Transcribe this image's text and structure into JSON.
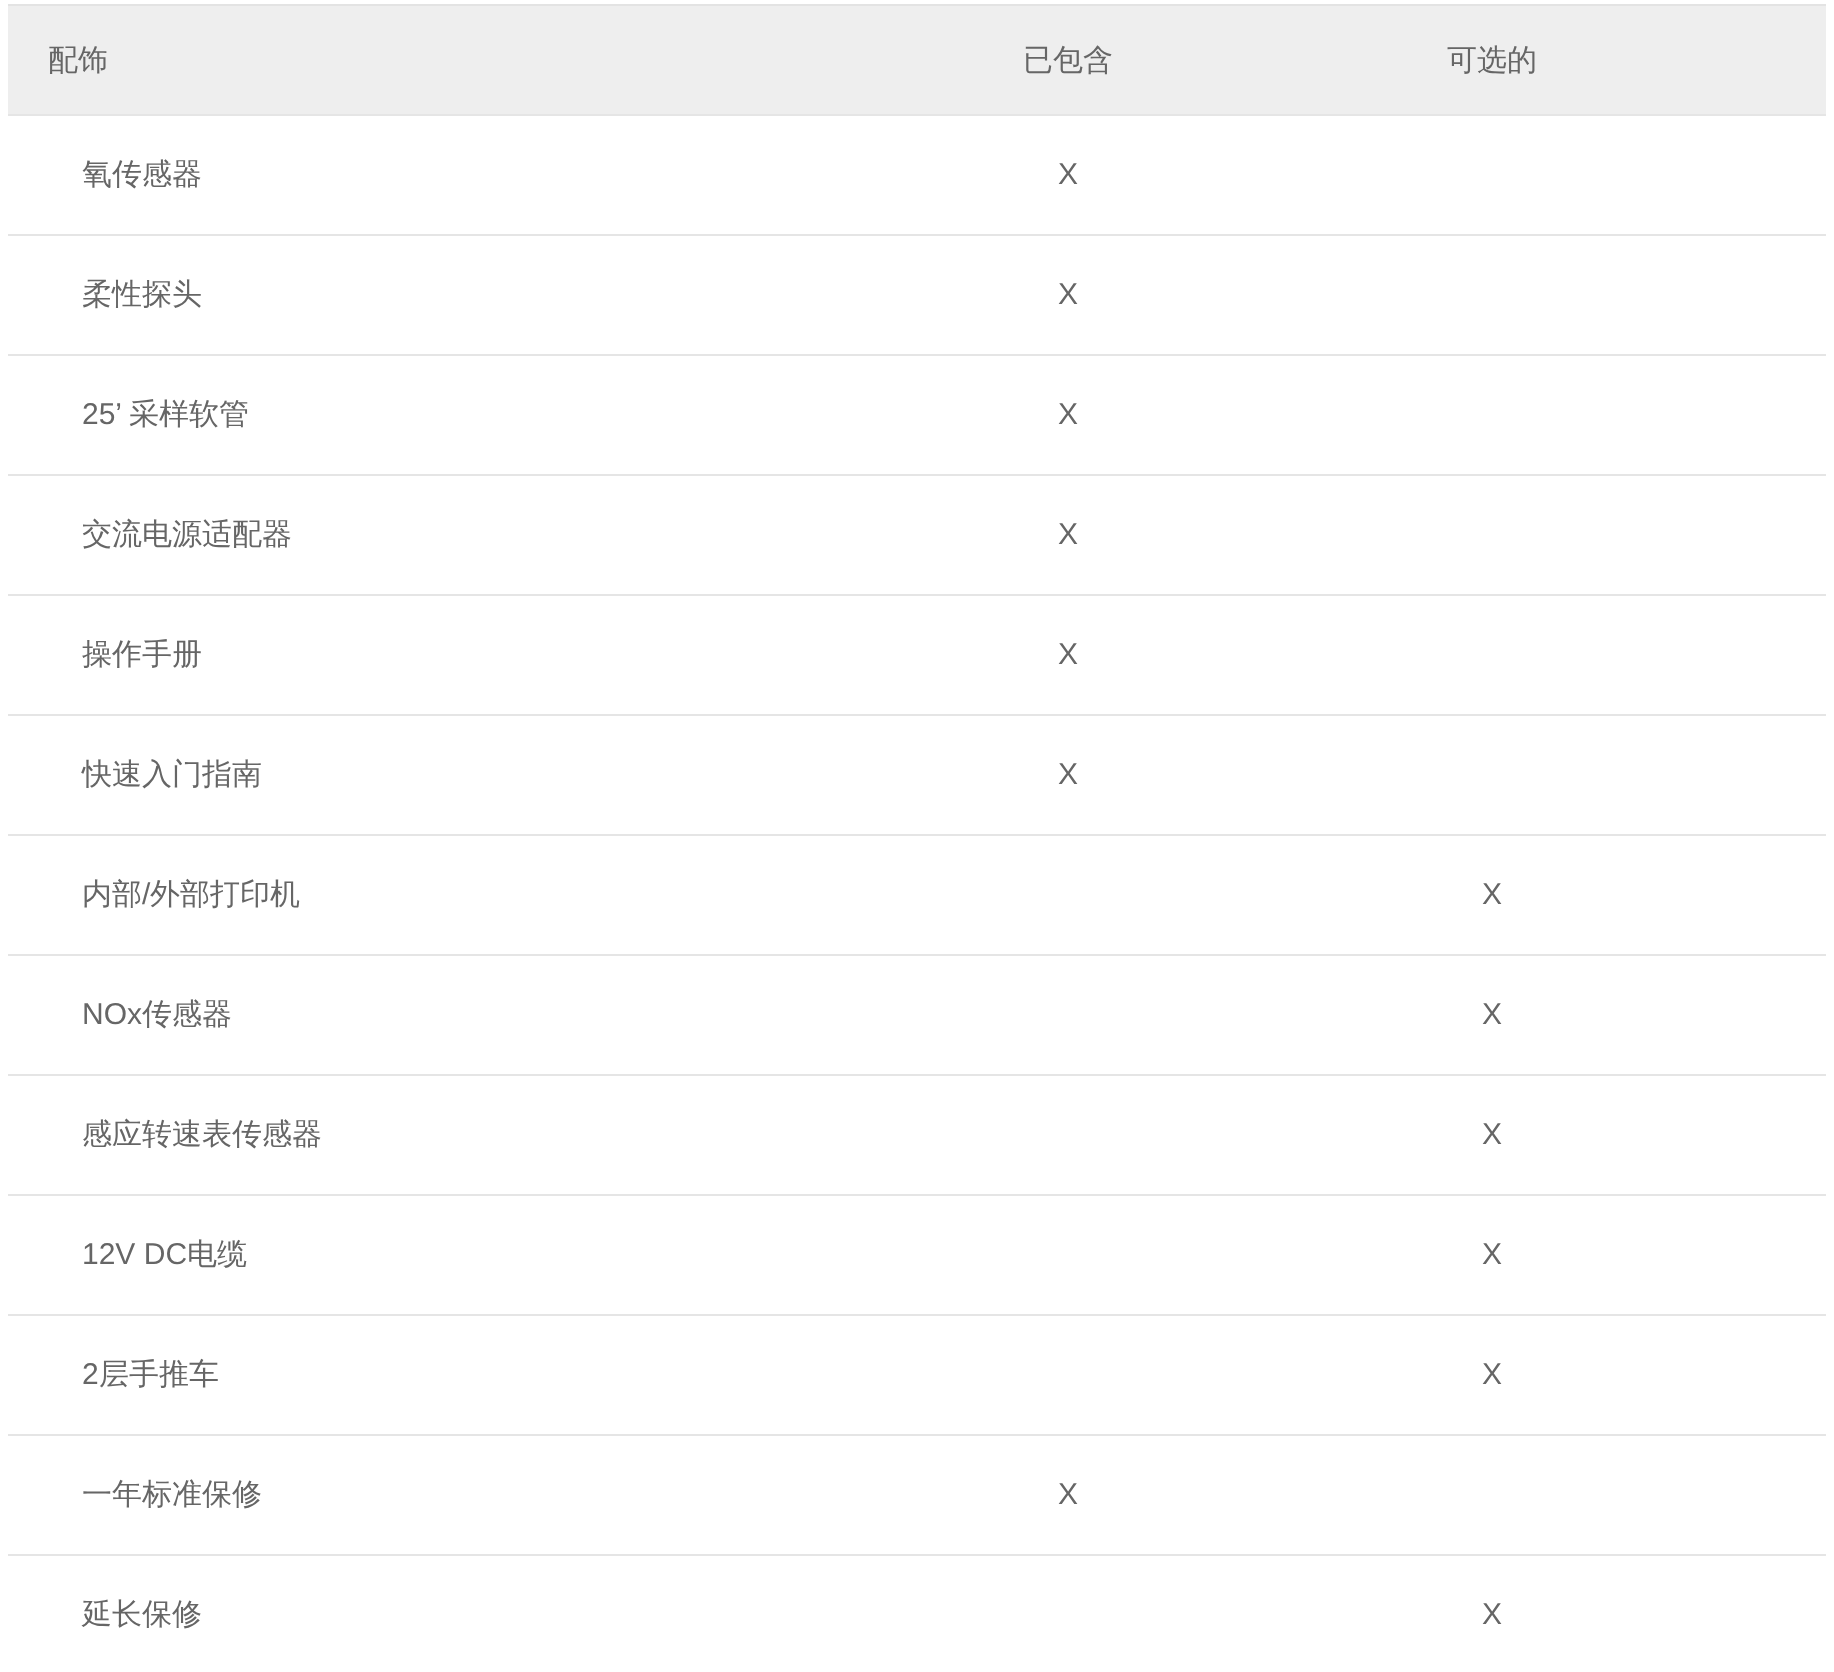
{
  "table": {
    "columns": [
      "配饰",
      "已包含",
      "可选的"
    ],
    "rows": [
      {
        "name": "氧传感器",
        "included": "X"
      },
      {
        "name": "柔性探头",
        "included": "X"
      },
      {
        "name": "25’ 采样软管",
        "included": "X"
      },
      {
        "name": "交流电源适配器",
        "included": "X"
      },
      {
        "name": "操作手册",
        "included": "X"
      },
      {
        "name": "快速入门指南",
        "included": "X"
      },
      {
        "name": "内部/外部打印机",
        "optional": "X"
      },
      {
        "name": "NOx传感器",
        "optional": "X"
      },
      {
        "name": "感应转速表传感器",
        "optional": "X"
      },
      {
        "name": "12V DC电缆",
        "optional": "X"
      },
      {
        "name": "2层手推车",
        "optional": "X"
      },
      {
        "name": "一年标准保修",
        "included": "X"
      },
      {
        "name": "延长保修",
        "optional": "X"
      }
    ]
  }
}
